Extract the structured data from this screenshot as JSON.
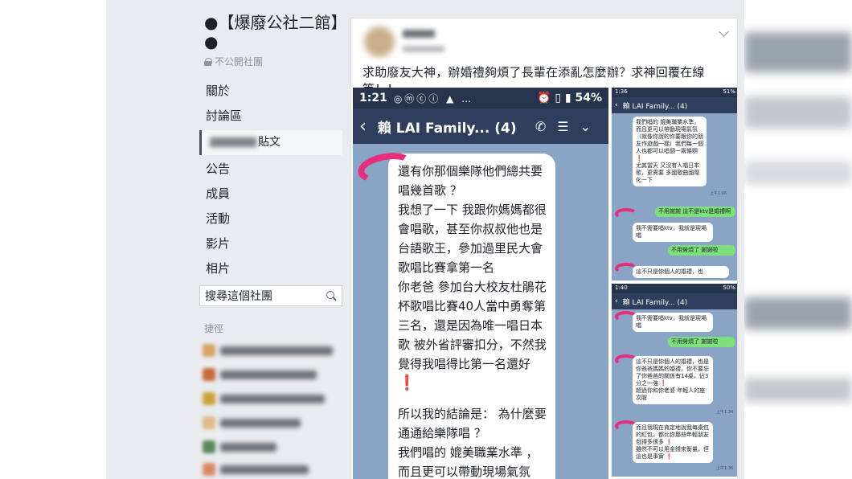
{
  "sidebar": {
    "group_name": "●【爆廢公社二館】●",
    "privacy": "不公開社團",
    "nav": [
      {
        "label": "關於"
      },
      {
        "label": "討論區"
      },
      {
        "label": "貼文"
      },
      {
        "label": "公告"
      },
      {
        "label": "成員"
      },
      {
        "label": "活動"
      },
      {
        "label": "影片"
      },
      {
        "label": "相片"
      }
    ],
    "search_placeholder": "搜尋這個社團",
    "shortcuts_label": "捷徑"
  },
  "post": {
    "text": "求助廢友大神，辦婚禮夠煩了長輩在添亂怎麼辦？求神回覆在線等！！"
  },
  "chat_big": {
    "time": "1:21",
    "battery": "54%",
    "title": "賴 LAI Family... (4)",
    "message": "還有你那個樂隊他們總共要唱幾首歌 ？\n我想了一下 我跟你媽媽都很會唱歌，甚至你叔叔他也是台語歌王，參加過里民大會歌唱比賽拿第一名\n 你老爸 參加台大校友杜鵑花杯歌唱比賽40人當中勇奪第三名，還是因為唯一唱日本歌 被外省評審扣分，不然我覺得我唱得比第一名還好",
    "message2": "所以我的結論是：  為什麼要通通給樂隊唱 ？\n我們唱的 媲美職業水準 ，而且更可以帶動現場氣氛\n（就像你說的你要跟你的朋",
    "exclaim": "❗"
  },
  "chat_small_top": {
    "time": "1:36",
    "battery": "51%",
    "title": "賴 LAI Family... (4)",
    "msg1": "我們唱的 媲美職業水準，而且更可以帶動現場氣氛（就像你說的你要跟你的朋友作遊戲一樣）我們每一個人也都可以唱個一兩條啊",
    "msg2": "尤其當天 又沒有人唱日本歌，更需要 多國歌曲國際化一下",
    "green1": "不用謝謝 這不是ktv是婚禮啊",
    "msg3": "我不需要唱ktv，我就是現場唱",
    "green2": "不用勞煩了 謝謝啦",
    "msg4": "這不只是你個人的婚禮，也"
  },
  "chat_small_bottom": {
    "time": "1:40",
    "battery": "50%",
    "title": "賴 LAI Family... (4)",
    "msg1": "我不需要唱ktv，我就是現場唱",
    "green1": "不用勞煩了 謝謝啦",
    "msg2": "這不只是你個人的婚禮，也是你爸爸媽媽的婚禮，你不要忘了你爸爸的關係有14桌，佔3分之一強",
    "msg2b": "超過你和你老婆 年輕人的座次喔",
    "msg3": "而且我現在肯定地說我每桌包的紅包，都比你那些年輕朋友包得多很多",
    "msg3b": "雖然不可以用金錢來衡量，但這也是事實"
  }
}
